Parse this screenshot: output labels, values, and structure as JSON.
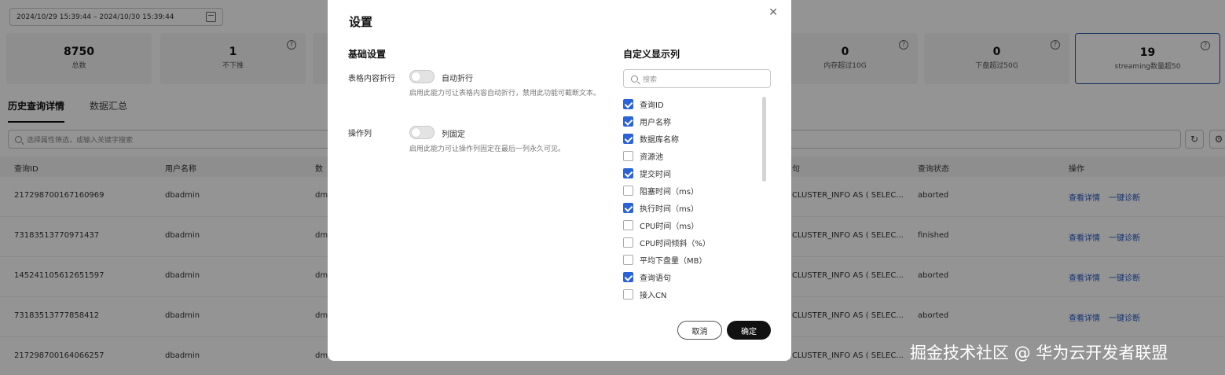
{
  "filter_bar": {
    "date_range": "2024/10/29 15:39:44 – 2024/10/30 15:39:44",
    "search_placeholder": "选择属性筛选，或输入关键字搜索"
  },
  "cards": [
    {
      "value": "8750",
      "label": "总数"
    },
    {
      "value": "1",
      "label": "不下推"
    },
    {
      "value": "0",
      "label": "内存超过10G"
    },
    {
      "value": "0",
      "label": "下盘超过50G"
    },
    {
      "value": "19",
      "label": "streaming数量超50"
    }
  ],
  "tabs": [
    {
      "label": "历史查询详情",
      "active": true
    },
    {
      "label": "数据汇总",
      "active": false
    }
  ],
  "table": {
    "headers": [
      "查询ID",
      "用户名称",
      "数",
      "句",
      "查询状态",
      "操作"
    ],
    "rows": [
      {
        "id": "217298700167160969",
        "user": "dbadmin",
        "db": "dm",
        "sql": "CLUSTER_INFO AS ( SELEC...",
        "status": "aborted",
        "actions": [
          "查看详情",
          "一键诊断"
        ]
      },
      {
        "id": "73183513770971437",
        "user": "dbadmin",
        "db": "dm",
        "sql": "CLUSTER_INFO AS ( SELEC...",
        "status": "finished",
        "actions": [
          "查看详情",
          "一键诊断"
        ]
      },
      {
        "id": "145241105612651597",
        "user": "dbadmin",
        "db": "dm",
        "sql": "CLUSTER_INFO AS ( SELEC...",
        "status": "aborted",
        "actions": [
          "查看详情",
          "一键诊断"
        ]
      },
      {
        "id": "73183513777858412",
        "user": "dbadmin",
        "db": "dm",
        "sql": "CLUSTER_INFO AS ( SELEC...",
        "status": "aborted",
        "actions": [
          "查看详情",
          "一键诊断"
        ]
      },
      {
        "id": "217298700164066257",
        "user": "dbadmin",
        "db": "dm",
        "sql": "CLUSTER_INFO AS ( SELEC...",
        "status": "",
        "actions": []
      }
    ]
  },
  "dialog": {
    "title": "设置",
    "basic_section_title": "基础设置",
    "wrap": {
      "label": "表格内容折行",
      "switch_text": "自动折行",
      "enabled": false,
      "description": "启用此能力可让表格内容自动折行，禁用此功能可截断文本。"
    },
    "pin": {
      "label": "操作列",
      "switch_text": "列固定",
      "enabled": false,
      "description": "启用此能力可让操作列固定在最后一列永久可见。"
    },
    "custom_section_title": "自定义显示列",
    "search_placeholder": "搜索",
    "columns": [
      {
        "label": "查询ID",
        "checked": true
      },
      {
        "label": "用户名称",
        "checked": true
      },
      {
        "label": "数据库名称",
        "checked": true
      },
      {
        "label": "资源池",
        "checked": false
      },
      {
        "label": "提交时间",
        "checked": true
      },
      {
        "label": "阻塞时间（ms）",
        "checked": false
      },
      {
        "label": "执行时间（ms）",
        "checked": true
      },
      {
        "label": "CPU时间（ms）",
        "checked": false
      },
      {
        "label": "CPU时间倾斜（%）",
        "checked": false
      },
      {
        "label": "平均下盘量（MB）",
        "checked": false
      },
      {
        "label": "查询语句",
        "checked": true
      },
      {
        "label": "接入CN",
        "checked": false
      }
    ],
    "cancel_label": "取消",
    "ok_label": "确定"
  },
  "watermark": "掘金技术社区 @ 华为云开发者联盟",
  "colors": {
    "accent": "#2a62d8",
    "overlay": "rgba(0,0,0,0.42)",
    "primary_button": "#111111"
  }
}
